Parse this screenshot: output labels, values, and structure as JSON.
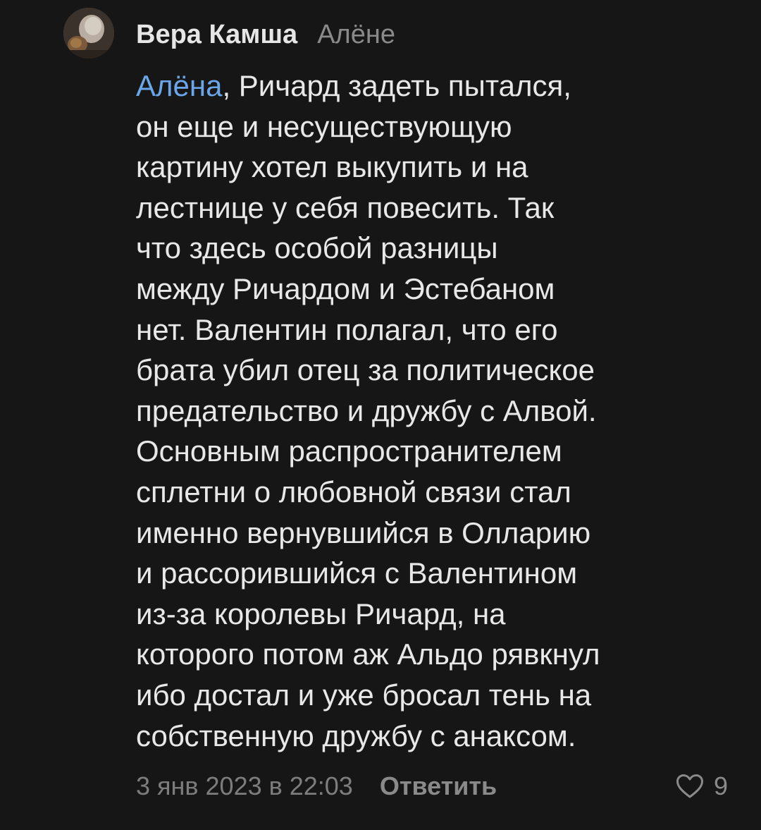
{
  "comment": {
    "author": "Вера Камша",
    "reply_to": "Алёне",
    "mention": "Алёна",
    "text_lines": [
      ", Ричард задеть пытался,",
      "он еще и несуществующую",
      "картину хотел выкупить и на",
      "лестнице у себя повесить. Так",
      "что здесь особой разницы",
      "между Ричардом и Эстебаном",
      "нет. Валентин полагал, что его",
      "брата убил отец за политическое",
      "предательство и дружбу с Алвой.",
      "Основным распространителем",
      "сплетни о любовной связи стал",
      "именно вернувшийся в Олларию",
      "и рассорившийся с Валентином",
      "из-за королевы Ричард, на",
      "которого потом аж Альдо рявкнул",
      "ибо достал и уже бросал тень на",
      "собственную дружбу с анаксом."
    ],
    "timestamp": "3 янв 2023 в 22:03",
    "reply_label": "Ответить",
    "like_icon": "heart-outline-icon",
    "like_count": "9"
  },
  "colors": {
    "background": "#161616",
    "text": "#e8e8e8",
    "mention": "#6aa6e8",
    "muted": "#8a8a8a"
  }
}
